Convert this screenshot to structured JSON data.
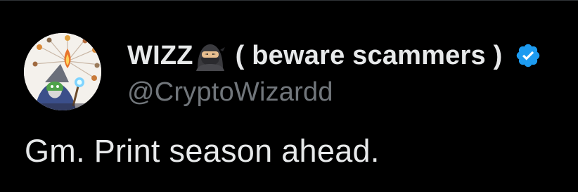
{
  "tweet": {
    "author": {
      "display_name": "WIZZ",
      "name_emoji": "ninja-emoji",
      "name_suffix": "( beware scammers )",
      "verified": true,
      "handle": "@CryptoWizardd"
    },
    "text": "Gm. Print season ahead."
  },
  "colors": {
    "background": "#000000",
    "primary_text": "#e7e9ea",
    "secondary_text": "#71767b",
    "verified_blue": "#1d9bf0",
    "divider": "#2f3336"
  }
}
